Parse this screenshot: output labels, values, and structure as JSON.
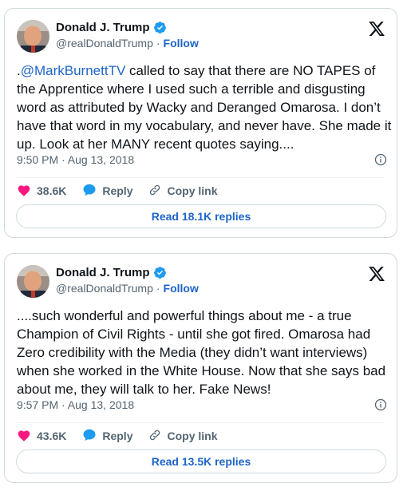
{
  "colors": {
    "accent": "#1d64c8",
    "heart": "#f91880",
    "verified": "#1d9bf0",
    "muted": "#536471"
  },
  "tweets": [
    {
      "author": {
        "name": "Donald J. Trump",
        "handle": "@realDonaldTrump",
        "separator": "·",
        "follow_label": "Follow",
        "avatar_icon": "avatar-photo",
        "verified_icon": "verified-badge"
      },
      "text_prefix": ".",
      "mention": "@MarkBurnettTV",
      "text_rest": " called to say that there are NO TAPES of the Apprentice where I used such a terrible and disgusting word as attributed by Wacky and Deranged Omarosa. I don’t have that word in my vocabulary, and never have. She made it up. Look at her MANY recent quotes saying....",
      "timestamp": "9:50 PM · Aug 13, 2018",
      "likes": "38.6K",
      "reply_label": "Reply",
      "copy_label": "Copy link",
      "read_replies_label": "Read 18.1K replies"
    },
    {
      "author": {
        "name": "Donald J. Trump",
        "handle": "@realDonaldTrump",
        "separator": "·",
        "follow_label": "Follow",
        "avatar_icon": "avatar-photo",
        "verified_icon": "verified-badge"
      },
      "text_prefix": "",
      "mention": "",
      "text_rest": "....such wonderful and powerful things about me - a true Champion of Civil Rights - until she got fired. Omarosa had Zero credibility with the Media (they didn’t want interviews) when she worked in the White House. Now that she says bad about me, they will talk to her. Fake News!",
      "timestamp": "9:57 PM · Aug 13, 2018",
      "likes": "43.6K",
      "reply_label": "Reply",
      "copy_label": "Copy link",
      "read_replies_label": "Read 13.5K replies"
    }
  ]
}
